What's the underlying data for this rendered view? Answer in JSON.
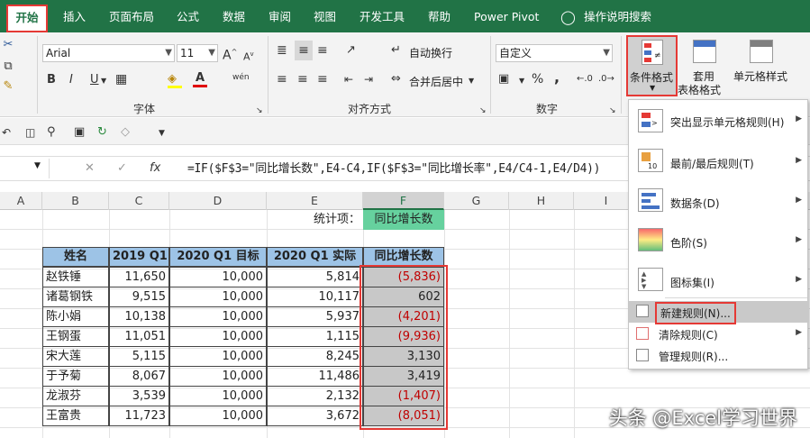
{
  "tabs": [
    {
      "label": "开始",
      "active": true
    },
    {
      "label": "插入"
    },
    {
      "label": "页面布局"
    },
    {
      "label": "公式"
    },
    {
      "label": "数据"
    },
    {
      "label": "审阅"
    },
    {
      "label": "视图"
    },
    {
      "label": "开发工具"
    },
    {
      "label": "帮助"
    },
    {
      "label": "Power Pivot"
    },
    {
      "label": "操作说明搜索"
    }
  ],
  "ribbon": {
    "font_name": "Arial",
    "font_size": "11",
    "font_group_label": "字体",
    "align_group_label": "对齐方式",
    "number_group_label": "数字",
    "wrap_text": "自动换行",
    "merge_center": "合并后居中",
    "number_format": "自定义",
    "percent": "%",
    "comma": ",",
    "cond_format": "条件格式",
    "table_format_1": "套用",
    "table_format_2": "表格格式",
    "cell_style": "单元格样式",
    "bold": "B",
    "italic": "I",
    "underline": "U",
    "font_color_letter": "A",
    "grow_font": "A",
    "shrink_font": "A",
    "phonetic": "wén"
  },
  "formula_bar": {
    "fx": "fx",
    "formula": "=IF($F$3=\"同比增长数\",E4-C4,IF($F$3=\"同比增长率\",E4/C4-1,E4/D4))"
  },
  "columns": [
    "A",
    "B",
    "C",
    "D",
    "E",
    "F",
    "G",
    "H",
    "I"
  ],
  "sheet": {
    "label_stat": "统计项：",
    "stat_value": "同比增长数",
    "headers": [
      "姓名",
      "2019 Q1",
      "2020 Q1 目标",
      "2020 Q1 实际",
      "同比增长数"
    ],
    "rows": [
      [
        "赵铁锤",
        "11,650",
        "10,000",
        "5,814",
        "(5,836)"
      ],
      [
        "诸葛钢铁",
        "9,515",
        "10,000",
        "10,117",
        "602"
      ],
      [
        "陈小娟",
        "10,138",
        "10,000",
        "5,937",
        "(4,201)"
      ],
      [
        "王钢蛋",
        "11,051",
        "10,000",
        "1,115",
        "(9,936)"
      ],
      [
        "宋大莲",
        "5,115",
        "10,000",
        "8,245",
        "3,130"
      ],
      [
        "于予菊",
        "8,067",
        "10,000",
        "11,486",
        "3,419"
      ],
      [
        "龙淑芬",
        "3,539",
        "10,000",
        "2,132",
        "(1,407)"
      ],
      [
        "王富贵",
        "11,723",
        "10,000",
        "3,672",
        "(8,051)"
      ]
    ],
    "negative_color": "#c00000",
    "header_fill": "#9dc3e6",
    "stat_fill": "#66d19e"
  },
  "cf_menu": {
    "items": [
      {
        "label": "突出显示单元格规则(H)",
        "icon": "highlight-rules-icon"
      },
      {
        "label": "最前/最后规则(T)",
        "icon": "top-bottom-rules-icon"
      },
      {
        "label": "数据条(D)",
        "icon": "data-bars-icon"
      },
      {
        "label": "色阶(S)",
        "icon": "color-scales-icon"
      },
      {
        "label": "图标集(I)",
        "icon": "icon-sets-icon"
      }
    ],
    "small_items": [
      {
        "label": "新建规则(N)...",
        "icon": "new-rule-icon",
        "highlighted": true
      },
      {
        "label": "清除规则(C)",
        "icon": "clear-rules-icon"
      },
      {
        "label": "管理规则(R)...",
        "icon": "manage-rules-icon"
      }
    ]
  },
  "watermark": "头条 @Excel学习世界",
  "accent": "#217346",
  "highlight_red": "#e53935"
}
